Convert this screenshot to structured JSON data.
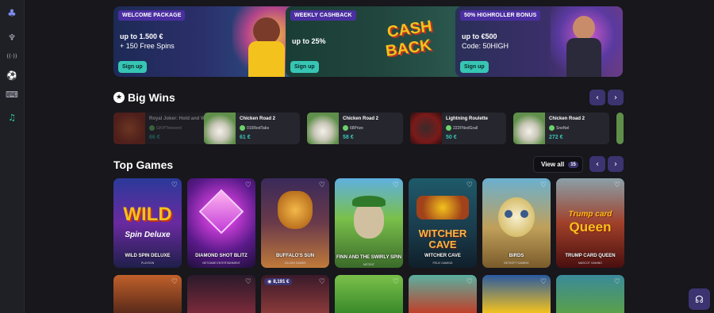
{
  "sidebar": {
    "items": [
      {
        "icon": "logo-icon",
        "glyph": "♣"
      },
      {
        "icon": "cherries-icon",
        "glyph": "♆"
      },
      {
        "icon": "live-broadcast-icon",
        "glyph": "((·))"
      },
      {
        "icon": "soccer-ball-icon",
        "glyph": "⚽"
      },
      {
        "icon": "gamepad-icon",
        "glyph": "⌨"
      },
      {
        "icon": "headset-icon",
        "glyph": "♫"
      }
    ]
  },
  "banners": [
    {
      "tag": "WELCOME PACKAGE",
      "line1": "up to 1.500 €",
      "line2": "+ 150 Free Spins",
      "cta": "Sign up"
    },
    {
      "tag": "WEEKLY CASHBACK",
      "line1": "up to 25%",
      "art_text_1": "CASH",
      "art_text_2": "BACK",
      "cta": "Sign up"
    },
    {
      "tag": "50% HIGHROLLER BONUS",
      "line1": "up to €500",
      "line2": "Code: 50HIGH",
      "cta": "Sign up"
    }
  ],
  "big_wins": {
    "title": "Big Wins",
    "items": [
      {
        "game": "Royal Joker: Hold and Win",
        "user": "GKIPTeleword",
        "amount": "66 €"
      },
      {
        "game": "Chicken Road 2",
        "user": "010RedTabs",
        "amount": "61 €"
      },
      {
        "game": "Chicken Road 2",
        "user": "68Prize",
        "amount": "58 €"
      },
      {
        "game": "Lightning Roulette",
        "user": "222FNedGrall",
        "amount": "50 €"
      },
      {
        "game": "Chicken Road 2",
        "user": "SneNel",
        "amount": "272 €"
      }
    ]
  },
  "top_games": {
    "title": "Top Games",
    "view_all": "View all",
    "count": "15",
    "tiles": [
      {
        "name": "WILD SPIN DELUXE",
        "provider": "PLAYSON",
        "art_1": "WILD",
        "art_2": "Spin Deluxe"
      },
      {
        "name": "DIAMOND SHOT BLITZ",
        "provider": "NETGAME ENTERTAINMENT"
      },
      {
        "name": "BUFFALO'S SUN",
        "provider": "ZILLION GAMES"
      },
      {
        "name": "FINN AND THE SWIRLY SPIN",
        "provider": "NETENT"
      },
      {
        "name": "WITCHER CAVE",
        "provider": "FELIX GAMING",
        "art_1": "WITCHER",
        "art_2": "CAVE"
      },
      {
        "name": "BIRDS",
        "provider": "BETSOFT GAMING"
      },
      {
        "name": "TRUMP CARD QUEEN",
        "provider": "MASCOT GAMING",
        "art_1": "Trump card",
        "art_2": "Queen"
      }
    ],
    "row2_badge": "8,191 €"
  },
  "colors": {
    "accent": "#37c5b4",
    "brand": "#4b2fa1",
    "nav_btn": "#3b3470",
    "background": "#17171c"
  }
}
